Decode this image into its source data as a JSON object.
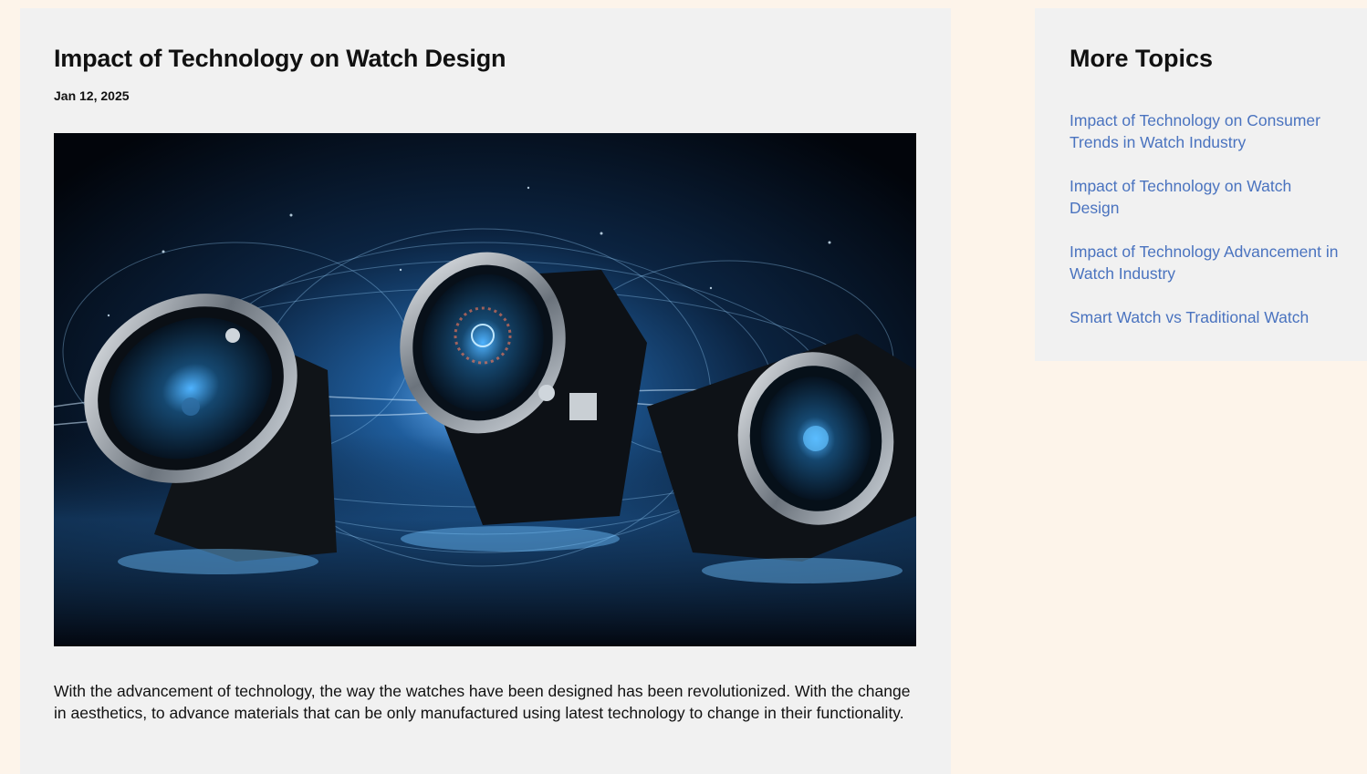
{
  "article": {
    "title": "Impact of Technology on Watch Design",
    "date": "Jan 12, 2025",
    "body": "With the advancement of technology, the way the watches have been designed has been revolutionized. With the change in aesthetics, to advance materials that can be only manufactured using latest technology to change in their functionality."
  },
  "sidebar": {
    "title": "More Topics",
    "links": [
      {
        "label": "Impact of Technology on Consumer Trends in Watch Industry"
      },
      {
        "label": "Impact of Technology on Watch Design"
      },
      {
        "label": "Impact of Technology Advancement in Watch Industry"
      },
      {
        "label": "Smart Watch vs Traditional Watch"
      }
    ]
  },
  "colors": {
    "page_background": "#fdf4ea",
    "panel_background": "#f1f1f1",
    "link": "#4a73bf",
    "text": "#111111"
  }
}
